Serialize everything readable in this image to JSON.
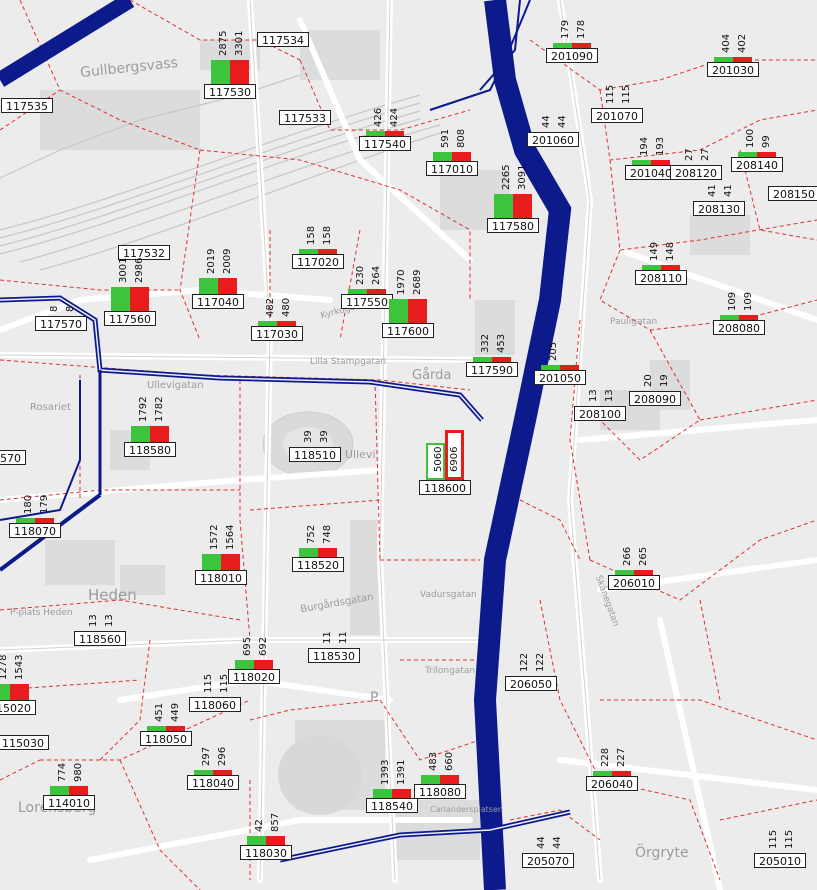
{
  "map_labels": [
    "Gullbergsvass",
    "Heden",
    "Lorensberg",
    "Örgryte",
    "Rosariet",
    "Ullevi",
    "Gårda",
    "Ullevigatan",
    "Burgårdsgatan",
    "Vadursgatan",
    "Skånegatan",
    "Trilongatan",
    "Kyrkogatan",
    "Lilla Stampgatan",
    "Pauligatan",
    "Carlandersplatsen",
    "P-plats Heden",
    "P"
  ],
  "zones": [
    {
      "id": "117534",
      "g": null,
      "r": null
    },
    {
      "id": "117530",
      "g": "2875",
      "r": "3301"
    },
    {
      "id": "117535",
      "g": null,
      "r": null
    },
    {
      "id": "117533",
      "g": null,
      "r": null
    },
    {
      "id": "117540",
      "g": "426",
      "r": "424"
    },
    {
      "id": "117010",
      "g": "591",
      "r": "808"
    },
    {
      "id": "117580",
      "g": "2265",
      "r": "3091"
    },
    {
      "id": "117532",
      "g": null,
      "r": null
    },
    {
      "id": "117020",
      "g": "158",
      "r": "158"
    },
    {
      "id": "117040",
      "g": "2019",
      "r": "2009"
    },
    {
      "id": "117560",
      "g": "3001",
      "r": "2986"
    },
    {
      "id": "117570",
      "g": "8",
      "r": "8"
    },
    {
      "id": "117030",
      "g": "482",
      "r": "480"
    },
    {
      "id": "117550",
      "g": "230",
      "r": "264"
    },
    {
      "id": "117600",
      "g": "1970",
      "r": "2689"
    },
    {
      "id": "117590",
      "g": "332",
      "r": "453"
    },
    {
      "id": "118580",
      "g": "1792",
      "r": "1782"
    },
    {
      "id": "118510",
      "g": "39",
      "r": "39"
    },
    {
      "id": "118600",
      "g": "5060",
      "r": "6906"
    },
    {
      "id": "118570",
      "g": "86",
      "r": null
    },
    {
      "id": "118070",
      "g": "180",
      "r": "179"
    },
    {
      "id": "118010",
      "g": "1572",
      "r": "1564"
    },
    {
      "id": "118520",
      "g": "752",
      "r": "748"
    },
    {
      "id": "118560",
      "g": "13",
      "r": "13"
    },
    {
      "id": "118530",
      "g": "11",
      "r": "11"
    },
    {
      "id": "118020",
      "g": "695",
      "r": "692"
    },
    {
      "id": "118060",
      "g": "115",
      "r": "115"
    },
    {
      "id": "115020",
      "g": "1278",
      "r": "1543"
    },
    {
      "id": "115030",
      "g": null,
      "r": null
    },
    {
      "id": "118050",
      "g": "451",
      "r": "449"
    },
    {
      "id": "118040",
      "g": "297",
      "r": "296"
    },
    {
      "id": "114010",
      "g": "774",
      "r": "980"
    },
    {
      "id": "118540",
      "g": "1393",
      "r": "1391"
    },
    {
      "id": "118080",
      "g": "483",
      "r": "660"
    },
    {
      "id": "118030",
      "g": "42",
      "r": "857"
    },
    {
      "id": "201090",
      "g": "179",
      "r": "178"
    },
    {
      "id": "201030",
      "g": "404",
      "r": "402"
    },
    {
      "id": "201070",
      "g": "115",
      "r": "115"
    },
    {
      "id": "201060",
      "g": "44",
      "r": "44"
    },
    {
      "id": "201040",
      "g": "194",
      "r": "193"
    },
    {
      "id": "208120",
      "g": "27",
      "r": "27"
    },
    {
      "id": "208140",
      "g": "100",
      "r": "99"
    },
    {
      "id": "208130",
      "g": "41",
      "r": "41"
    },
    {
      "id": "208150",
      "g": null,
      "r": null
    },
    {
      "id": "208110",
      "g": "149",
      "r": "148"
    },
    {
      "id": "208080",
      "g": "109",
      "r": "109"
    },
    {
      "id": "201050",
      "g": "205",
      "r": null
    },
    {
      "id": "208100",
      "g": "13",
      "r": "13"
    },
    {
      "id": "208090",
      "g": "20",
      "r": "19"
    },
    {
      "id": "206010",
      "g": "266",
      "r": "265"
    },
    {
      "id": "206050",
      "g": "122",
      "r": "122"
    },
    {
      "id": "206040",
      "g": "228",
      "r": "227"
    },
    {
      "id": "205070",
      "g": "44",
      "r": "44"
    },
    {
      "id": "205010",
      "g": "115",
      "r": "115"
    }
  ],
  "colors": {
    "outgoing": "#3cc43c",
    "incoming": "#e81c1c",
    "flow_line": "#0c1a8c",
    "zone_border": "#e03030",
    "road": "#ffffff",
    "background": "#ececec"
  }
}
